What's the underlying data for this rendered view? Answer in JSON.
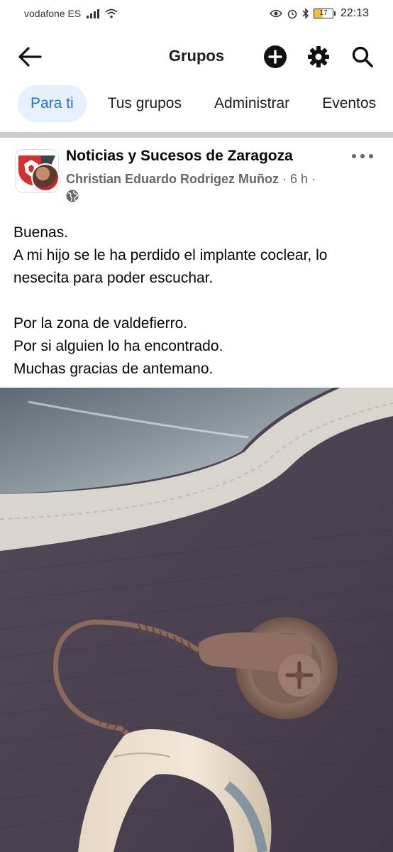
{
  "status_bar": {
    "carrier": "vodafone ES",
    "battery": "17",
    "time": "22:13"
  },
  "header": {
    "title": "Grupos",
    "back_icon": "arrow-left-icon",
    "add_icon": "plus-circle-icon",
    "settings_icon": "gear-icon",
    "search_icon": "search-icon"
  },
  "tabs": [
    {
      "label": "Para ti",
      "active": true
    },
    {
      "label": "Tus grupos",
      "active": false
    },
    {
      "label": "Administrar",
      "active": false
    },
    {
      "label": "Eventos",
      "active": false
    }
  ],
  "post": {
    "group_name": "Noticias y Sucesos de Zaragoza",
    "author": "Christian Eduardo Rodrigez Muñoz",
    "time": " · 6 h ·",
    "privacy_icon": "globe-icon",
    "body": {
      "line1": "Buenas.",
      "line2": "A mi hijo se le ha perdido el implante coclear, lo",
      "line3": "nesecita para poder escuchar.",
      "line4": "Por la zona de valdefierro.",
      "line5": "Por si alguien lo ha encontrado.",
      "line6": "Muchas gracias de antemano."
    }
  },
  "colors": {
    "accent": "#1b74e4",
    "active_tab_bg": "#e7f0fd",
    "secondary_text": "#65676b"
  }
}
